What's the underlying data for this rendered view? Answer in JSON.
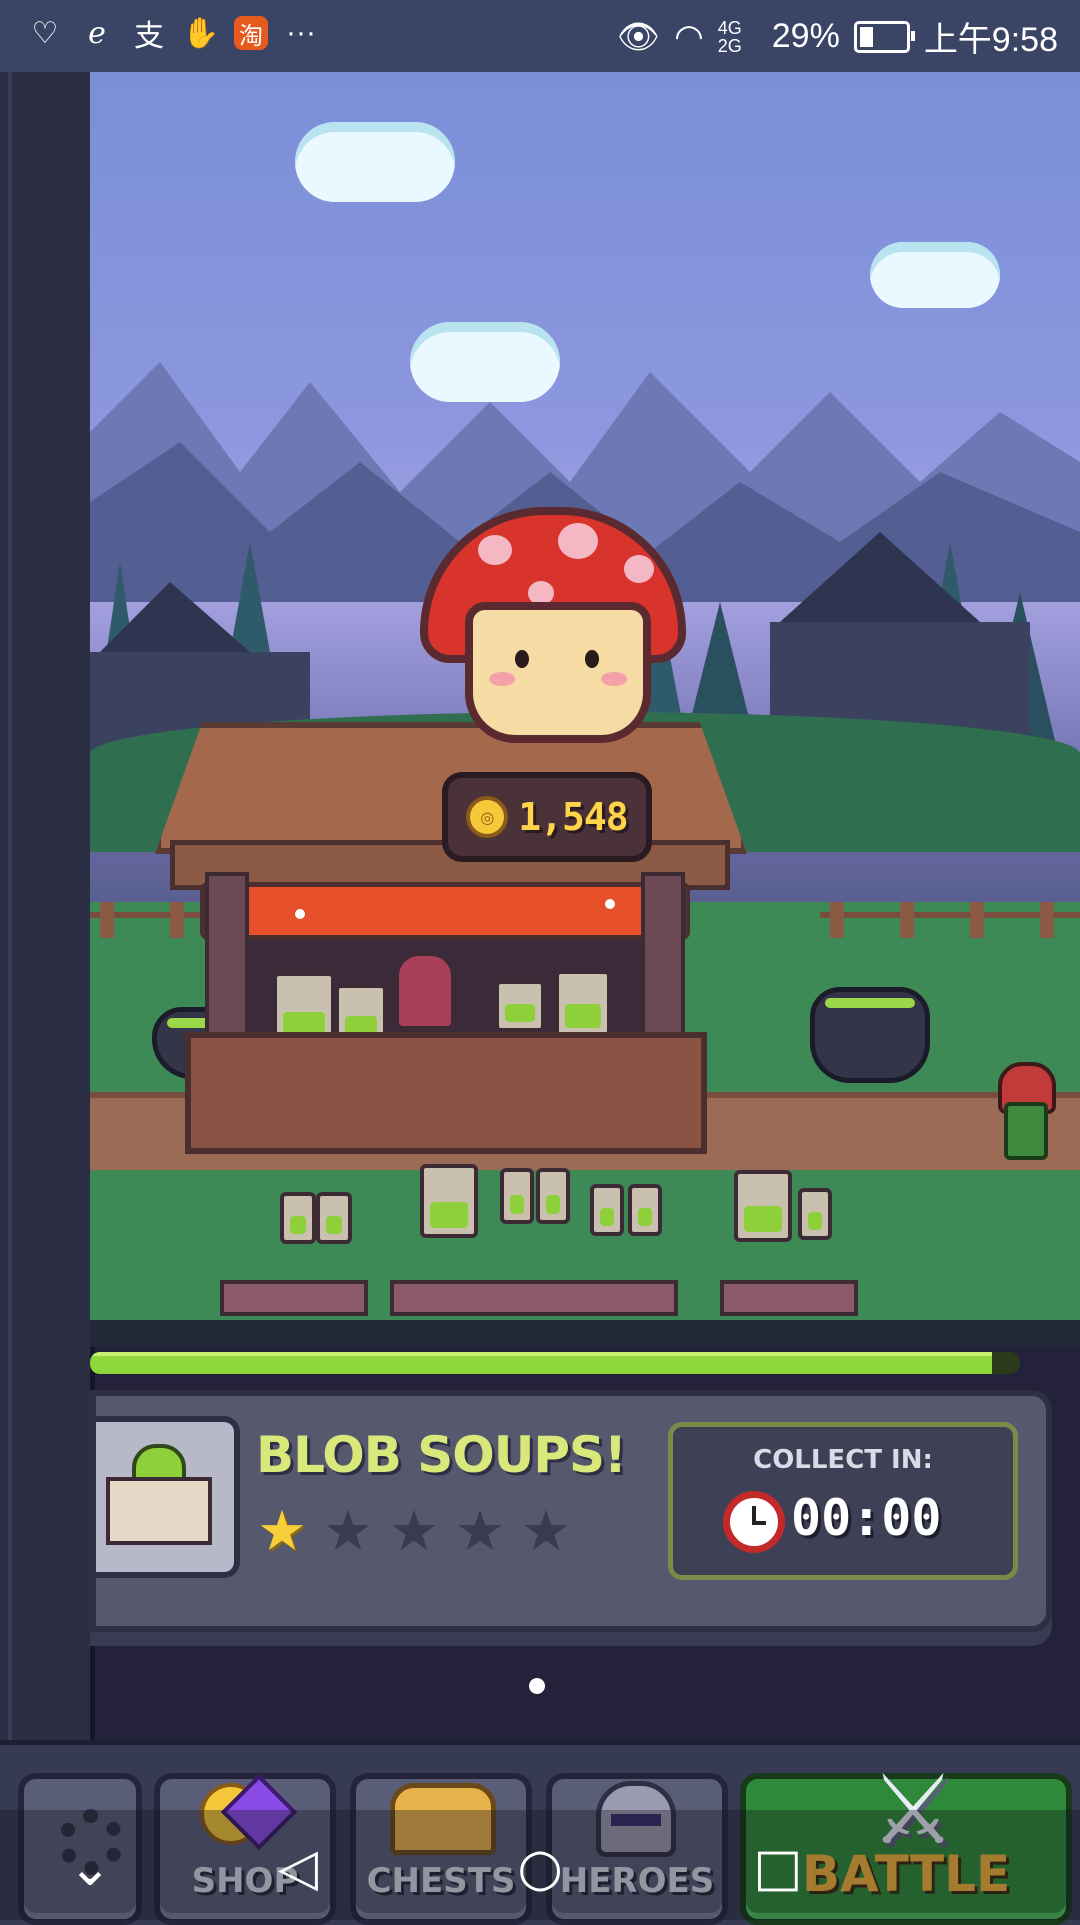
{
  "status_bar": {
    "left_icons": [
      "heart-pulse-icon",
      "e-icon",
      "alipay-icon",
      "hand-icon",
      "taobao-icon",
      "more-icon"
    ],
    "alipay_char": "支",
    "taobao_char": "淘",
    "more": "···",
    "network": "4G 2G",
    "battery": "29%",
    "battery_level": 0.29,
    "time": "上午9:58"
  },
  "shop": {
    "coins": "1,548",
    "progress": 0.97,
    "item_name": "BLOB SOUPS!",
    "stars_total": 5,
    "stars_filled": 1,
    "collect_label": "COLLECT IN:",
    "timer": "00:00"
  },
  "tabs": [
    {
      "label": "",
      "icon": "settings-gear-icon"
    },
    {
      "label": "SHOP",
      "icon": "coin-gem-icon"
    },
    {
      "label": "CHESTS",
      "icon": "chest-icon"
    },
    {
      "label": "HEROES",
      "icon": "helmet-icon"
    },
    {
      "label": "BATTLE",
      "icon": "crossed-swords-icon"
    }
  ],
  "nav": {
    "down": "⌄",
    "back": "◁",
    "home": "○",
    "recent": "□"
  },
  "colors": {
    "accent_green": "#8ed63a",
    "title_yellow": "#d8e87a",
    "battle_green": "#2e8a3a",
    "coin_gold": "#ffd44a"
  }
}
